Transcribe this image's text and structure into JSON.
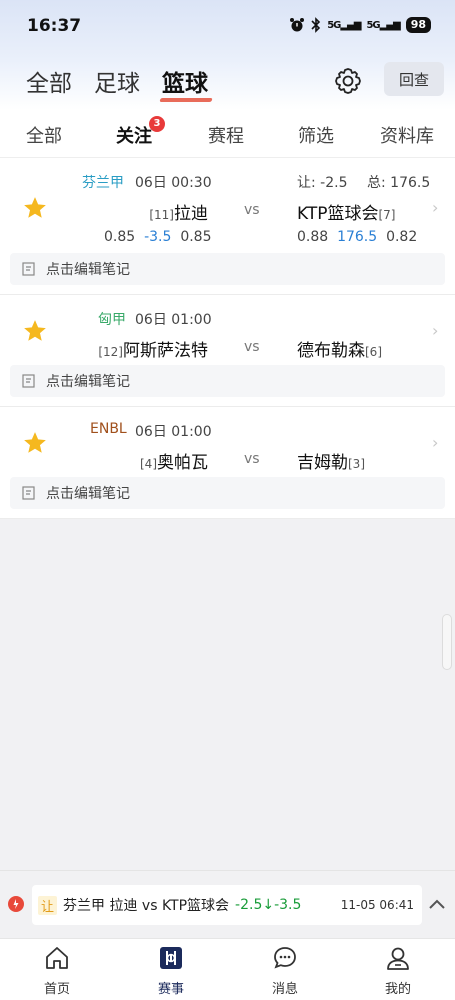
{
  "status_bar": {
    "time": "16:37",
    "signal_1": "5G",
    "signal_2": "5G",
    "battery": "98"
  },
  "header": {
    "sport_tabs": [
      {
        "label": "全部"
      },
      {
        "label": "足球"
      },
      {
        "label": "篮球"
      }
    ],
    "active_sport": "篮球",
    "review_label": "回查"
  },
  "sub_tabs": [
    {
      "label": "全部"
    },
    {
      "label": "关注",
      "badge": "3"
    },
    {
      "label": "赛程"
    },
    {
      "label": "筛选"
    },
    {
      "label": "资料库"
    }
  ],
  "matches": [
    {
      "league": "芬兰甲",
      "league_color": "#2a9dc4",
      "time": "06日 00:30",
      "handicap": "让: -2.5",
      "total": "总: 176.5",
      "home_rank": "[11]",
      "home": "拉迪",
      "vs": "vs",
      "away": "KTP篮球会",
      "away_rank": "[7]",
      "odds_left": [
        "0.85",
        "-3.5",
        "0.85"
      ],
      "odds_right": [
        "0.88",
        "176.5",
        "0.82"
      ],
      "note": "点击编辑笔记"
    },
    {
      "league": "匈甲",
      "league_color": "#3aaa6a",
      "time": "06日 01:00",
      "home_rank": "[12]",
      "home": "阿斯萨法特",
      "vs": "vs",
      "away": "德布勒森",
      "away_rank": "[6]",
      "note": "点击编辑笔记"
    },
    {
      "league": "ENBL",
      "league_color": "#a0501c",
      "time": "06日 01:00",
      "home_rank": "[4]",
      "home": "奥帕瓦",
      "vs": "vs",
      "away": "吉姆勒",
      "away_rank": "[3]",
      "note": "点击编辑笔记"
    }
  ],
  "ticker": {
    "tag": "让",
    "text": "芬兰甲  拉迪  vs  KTP篮球会",
    "change": "-2.5↓-3.5",
    "time": "11-05 06:41"
  },
  "bottom_nav": [
    {
      "label": "首页",
      "icon": "home-icon"
    },
    {
      "label": "赛事",
      "icon": "match-icon",
      "active": true
    },
    {
      "label": "消息",
      "icon": "message-icon"
    },
    {
      "label": "我的",
      "icon": "profile-icon"
    }
  ],
  "colors": {
    "accent": "#e86b5a",
    "star": "#f5b81f",
    "odds_blue": "#2a7fd4",
    "nav_active": "#1b2a5b"
  }
}
